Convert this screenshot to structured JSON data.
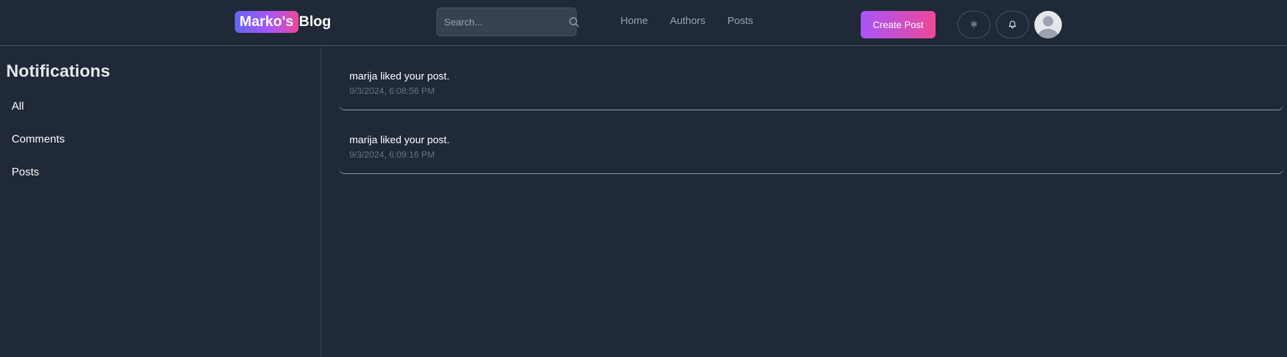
{
  "header": {
    "logo_badge": "Marko's",
    "logo_text": "Blog",
    "search_placeholder": "Search...",
    "nav": [
      {
        "label": "Home"
      },
      {
        "label": "Authors"
      },
      {
        "label": "Posts"
      }
    ],
    "create_post_label": "Create Post",
    "theme_icon": "⚛",
    "icons": [
      "search-icon",
      "theme-icon",
      "bell-icon",
      "avatar-icon"
    ]
  },
  "sidebar": {
    "title": "Notifications",
    "items": [
      {
        "label": "All"
      },
      {
        "label": "Comments"
      },
      {
        "label": "Posts"
      }
    ]
  },
  "notifications": [
    {
      "message": "marija liked your post.",
      "time": "9/3/2024, 6:08:56 PM"
    },
    {
      "message": "marija liked your post.",
      "time": "9/3/2024, 6:09:16 PM"
    }
  ],
  "colors": {
    "background": "#1f2937",
    "accent_start": "#a855f7",
    "accent_end": "#ec4899",
    "logo_gradient_start": "#6366f1"
  }
}
